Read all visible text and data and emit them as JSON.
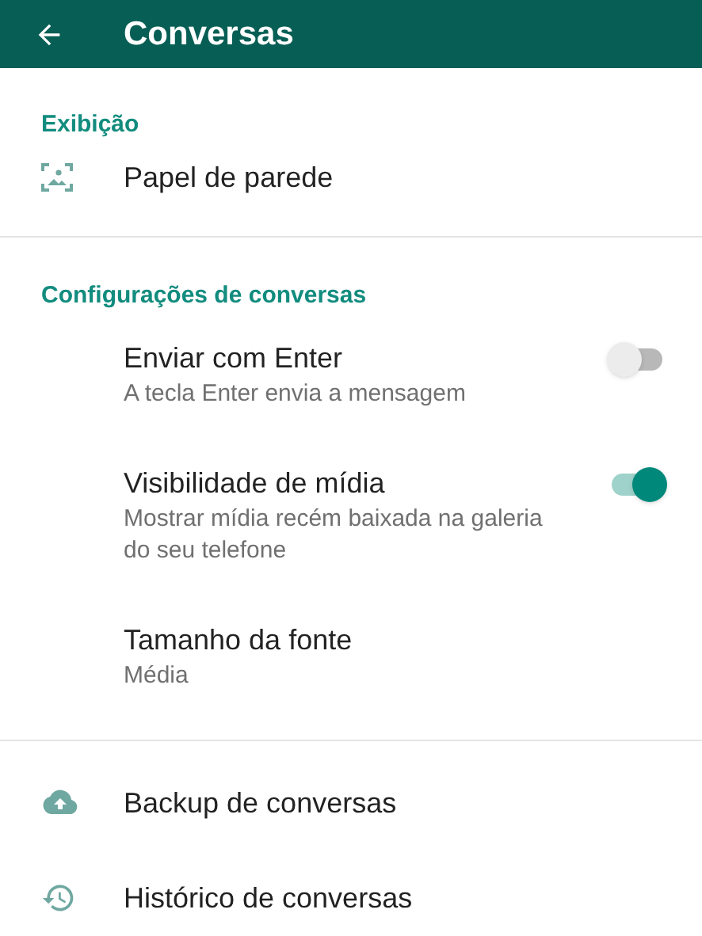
{
  "header": {
    "title": "Conversas"
  },
  "sections": [
    {
      "heading": "Exibição",
      "items": [
        {
          "kind": "wallpaper",
          "title": "Papel de parede"
        }
      ]
    },
    {
      "heading": "Configurações de conversas",
      "items": [
        {
          "kind": "toggle",
          "title": "Enviar com Enter",
          "subtitle": "A tecla Enter envia a mensagem",
          "on": false
        },
        {
          "kind": "toggle",
          "title": "Visibilidade de mídia",
          "subtitle": "Mostrar mídia recém baixada na galeria do seu telefone",
          "on": true
        },
        {
          "kind": "choice",
          "title": "Tamanho da fonte",
          "subtitle": "Média"
        }
      ]
    },
    {
      "items": [
        {
          "kind": "backup",
          "title": "Backup de conversas"
        },
        {
          "kind": "history",
          "title": "Histórico de conversas"
        }
      ]
    }
  ]
}
